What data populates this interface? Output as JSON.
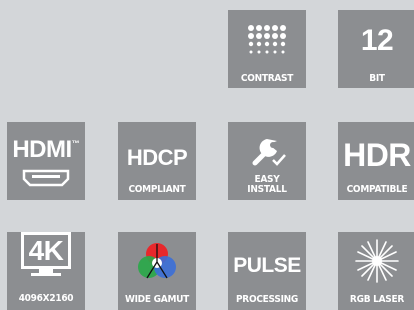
{
  "background": "#d3d6d9",
  "tile_color": "#8c8e91",
  "tiles": [
    {
      "id": "contrast",
      "icon": "dot-matrix-icon",
      "big": "",
      "caption": "CONTRAST"
    },
    {
      "id": "bit",
      "icon": "",
      "big": "12",
      "caption": "BIT"
    },
    {
      "id": "hdmi",
      "icon": "hdmi-port-icon",
      "big": "HDMI",
      "sup": "™",
      "caption": ""
    },
    {
      "id": "hdcp",
      "icon": "",
      "big": "HDCP",
      "caption": "COMPLIANT"
    },
    {
      "id": "easy",
      "icon": "wrench-check-icon",
      "big": "",
      "caption_line1": "EASY",
      "caption_line2": "INSTALL"
    },
    {
      "id": "hdr",
      "icon": "",
      "big": "HDR",
      "caption": "COMPATIBLE"
    },
    {
      "id": "k4",
      "icon": "monitor-4k-icon",
      "big": "4K",
      "caption": "4096X2160"
    },
    {
      "id": "wide",
      "icon": "rgb-circles-icon",
      "big": "",
      "caption": "WIDE GAMUT"
    },
    {
      "id": "pulse",
      "icon": "",
      "big": "PULSE",
      "caption": "PROCESSING"
    },
    {
      "id": "rgb",
      "icon": "laser-burst-icon",
      "big": "",
      "caption": "RGB LASER"
    }
  ]
}
